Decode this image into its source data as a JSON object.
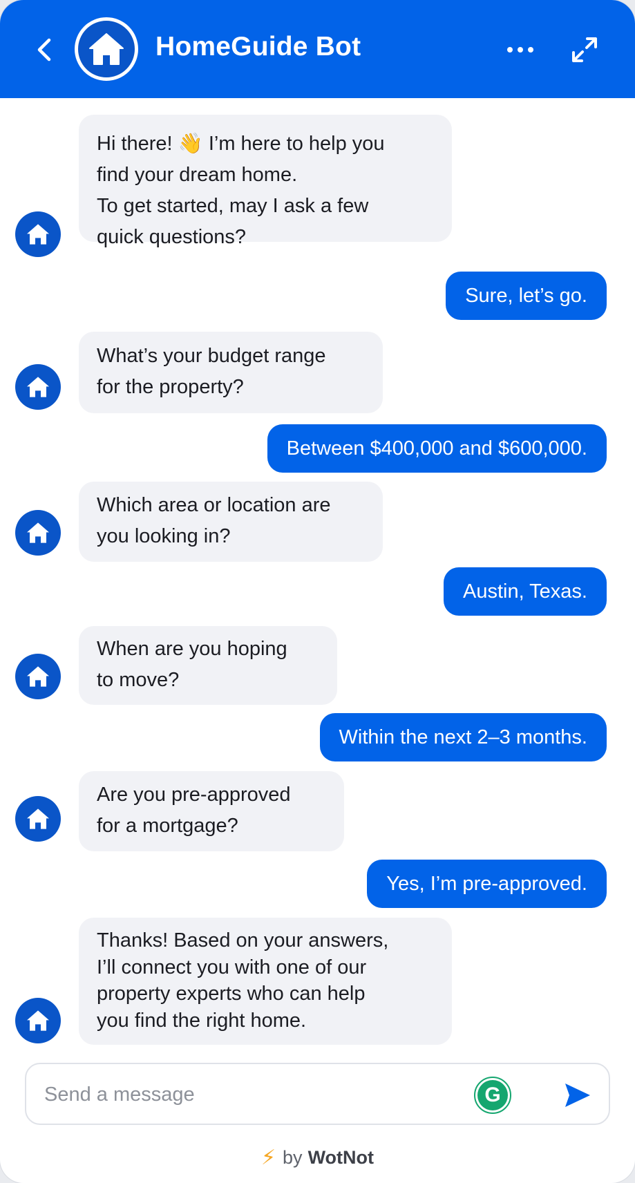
{
  "header": {
    "title": "HomeGuide Bot",
    "back_icon": "chevron-left-icon",
    "more_icon": "more-horizontal-icon",
    "expand_icon": "expand-icon",
    "brand_color": "#0263e8"
  },
  "messages": [
    {
      "from": "bot",
      "lines": [
        "Hi there! 👋 I’m here to help you",
        "find your dream home.",
        "To get started, may I ask a few",
        "quick questions?"
      ]
    },
    {
      "from": "user",
      "text": "Sure, let’s go."
    },
    {
      "from": "bot",
      "lines": [
        "What’s your budget range",
        "for the property?"
      ]
    },
    {
      "from": "user",
      "text": "Between $400,000 and $600,000."
    },
    {
      "from": "bot",
      "lines": [
        "Which area or location are",
        "you looking in?"
      ]
    },
    {
      "from": "user",
      "text": "Austin, Texas."
    },
    {
      "from": "bot",
      "lines": [
        "When are you hoping",
        "to move?"
      ]
    },
    {
      "from": "user",
      "text": "Within the next 2–3 months."
    },
    {
      "from": "bot",
      "lines": [
        "Are you pre-approved",
        "for a mortgage?"
      ]
    },
    {
      "from": "user",
      "text": "Yes, I’m pre-approved."
    },
    {
      "from": "bot",
      "lines": [
        "Thanks! Based on your answers,",
        "I’ll connect you with one of our",
        "property experts who can help",
        "you find the right home."
      ]
    }
  ],
  "composer": {
    "placeholder": "Send a message",
    "value": "",
    "send_icon": "send-icon",
    "grammarly_icon": "grammarly-icon"
  },
  "footer": {
    "prefix": "by",
    "brand": "WotNot",
    "bolt_icon": "lightning-icon"
  }
}
